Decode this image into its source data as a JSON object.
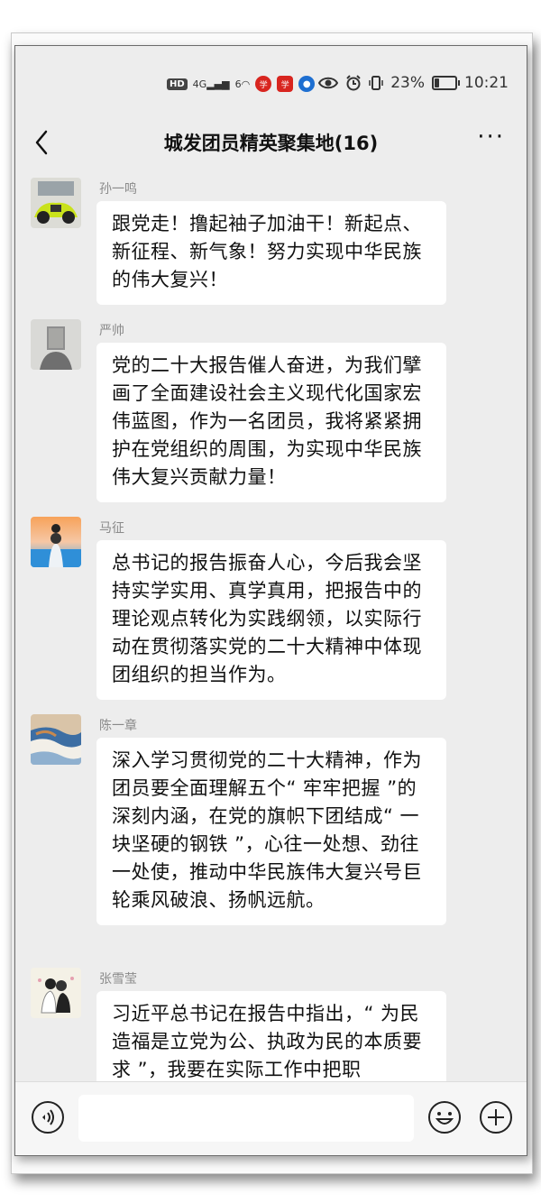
{
  "status_bar": {
    "hd": "HD",
    "network": "4G",
    "wifi": "6",
    "battery_percent": "23%",
    "battery_level": 0.23,
    "time": "10:21",
    "icons": [
      "hd-icon",
      "signal-icon",
      "wifi-icon",
      "xuexi-icon",
      "xuexi-square-icon",
      "app-blue-icon",
      "eye-icon",
      "alarm-icon",
      "vibrate-icon",
      "battery-icon"
    ]
  },
  "header": {
    "back_icon": "back-chevron-icon",
    "title": "城发团员精英聚集地(16)",
    "more_label": "···"
  },
  "messages": [
    {
      "sender": "孙一鸣",
      "text": "跟党走！撸起袖子加油干！新起点、新征程、新气象！努力实现中华民族的伟大复兴！"
    },
    {
      "sender": "严帅",
      "text": "党的二十大报告催人奋进，为我们擘画了全面建设社会主义现代化国家宏伟蓝图，作为一名团员，我将紧紧拥护在党组织的周围，为实现中华民族伟大复兴贡献力量！"
    },
    {
      "sender": "马征",
      "text": "总书记的报告振奋人心，今后我会坚持实学实用、真学真用，把报告中的理论观点转化为实践纲领，以实际行动在贯彻落实党的二十大精神中体现团组织的担当作为。"
    },
    {
      "sender": "陈一章",
      "text": "深入学习贯彻党的二十大精神，作为团员要全面理解五个“ 牢牢把握 ”的深刻内涵，在党的旗帜下团结成“ 一块坚硬的钢铁 ”，心往一处想、劲往一处使，推动中华民族伟大复兴号巨轮乘风破浪、扬帆远航。"
    },
    {
      "sender": "张雪莹",
      "text": "习近平总书记在报告中指出，“ 为民造福是立党为公、执政为民的本质要求 ”，我要在实际工作中把职"
    }
  ],
  "input_bar": {
    "voice_icon": "voice-icon",
    "emoji_icon": "emoji-icon",
    "plus_icon": "plus-icon",
    "voice_glyph": "◀)",
    "plus_glyph": "+"
  }
}
